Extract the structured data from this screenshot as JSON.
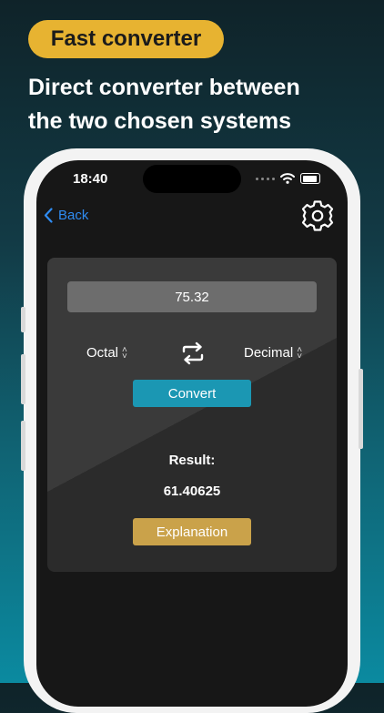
{
  "promo": {
    "badge": "Fast converter",
    "headline_line1": "Direct converter between",
    "headline_line2": "the two chosen systems"
  },
  "status_bar": {
    "time": "18:40"
  },
  "nav": {
    "back_label": "Back",
    "settings_icon": "gear-icon"
  },
  "converter": {
    "input_value": "75.32",
    "from_system": "Octal",
    "to_system": "Decimal",
    "swap_icon": "swap-arrows-icon",
    "convert_label": "Convert",
    "result_label": "Result:",
    "result_value": "61.40625",
    "explanation_label": "Explanation"
  },
  "colors": {
    "badge": "#e7b331",
    "accent_blue": "#1b97b3",
    "explanation_gold": "#caa24a",
    "back_link": "#2f8cf2"
  }
}
